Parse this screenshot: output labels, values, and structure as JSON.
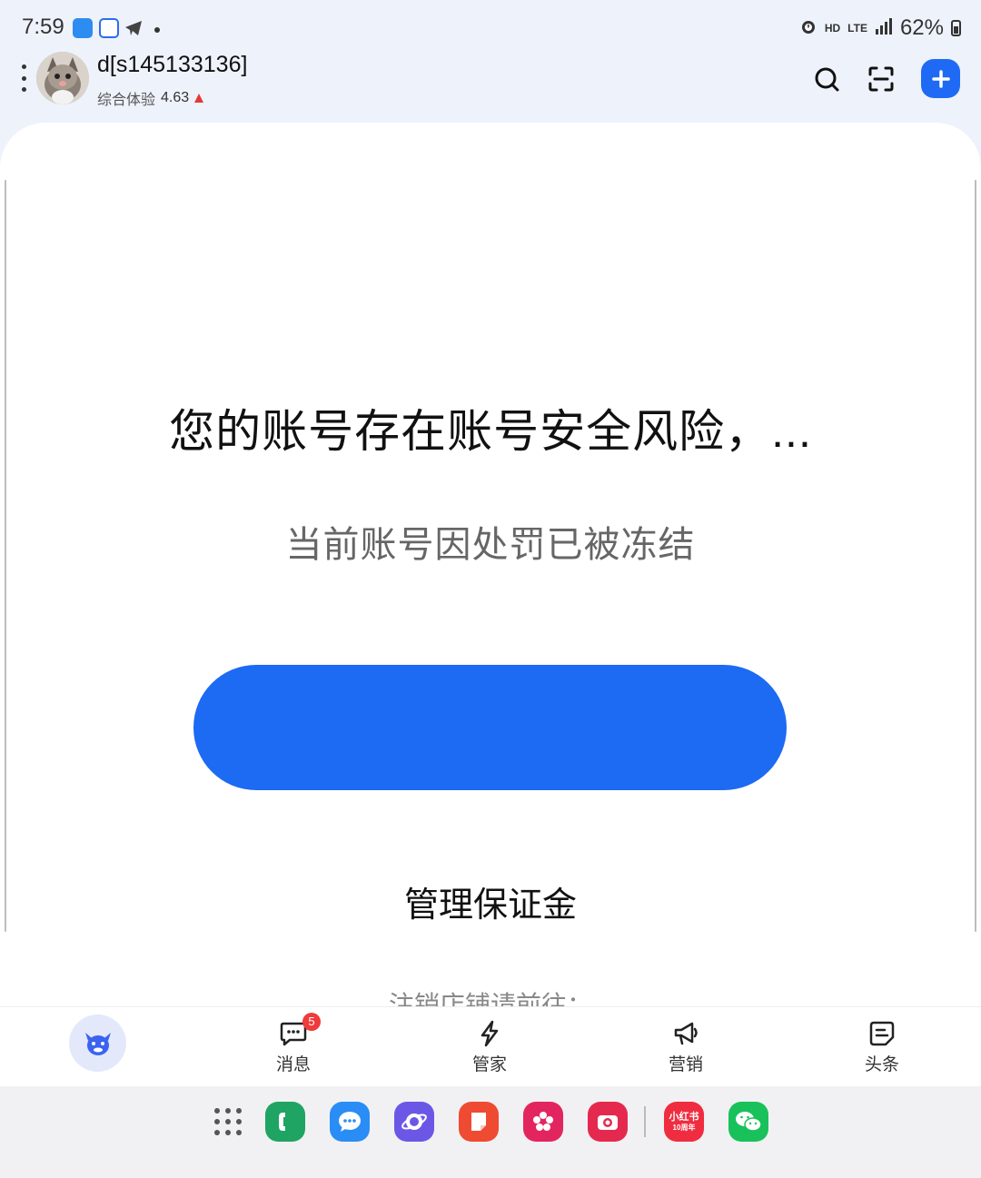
{
  "status_bar": {
    "time": "7:59",
    "network_hd": "HD",
    "network_lte": "LTE",
    "battery_text": "62%",
    "battery_level": 0.62
  },
  "header": {
    "shop_name": "d[s145133136]",
    "experience_label": "综合体验",
    "experience_score": "4.63"
  },
  "main": {
    "title": "您的账号存在账号安全风险，...",
    "subtitle": "当前账号因处罚已被冻结",
    "primary_button_label": "",
    "manage_deposit_link": "管理保证金",
    "cancel_shop_text": "注销店铺请前往："
  },
  "tabbar": {
    "items": [
      {
        "label": "",
        "icon": "home-mascot-icon"
      },
      {
        "label": "消息",
        "icon": "message-icon",
        "badge": "5"
      },
      {
        "label": "管家",
        "icon": "lightning-icon"
      },
      {
        "label": "营销",
        "icon": "megaphone-icon"
      },
      {
        "label": "头条",
        "icon": "news-icon"
      }
    ]
  },
  "dock": {
    "apps": [
      "phone-app",
      "messages-app",
      "browser-app",
      "notes-app",
      "gallery-app",
      "camera-app",
      "xiaohongshu-app",
      "wechat-app"
    ],
    "xiaohongshu_label": "小红书",
    "xiaohongshu_sub": "10周年"
  },
  "colors": {
    "accent": "#1d6af3",
    "badge": "#ef3b3b",
    "background": "#eef2fb"
  }
}
